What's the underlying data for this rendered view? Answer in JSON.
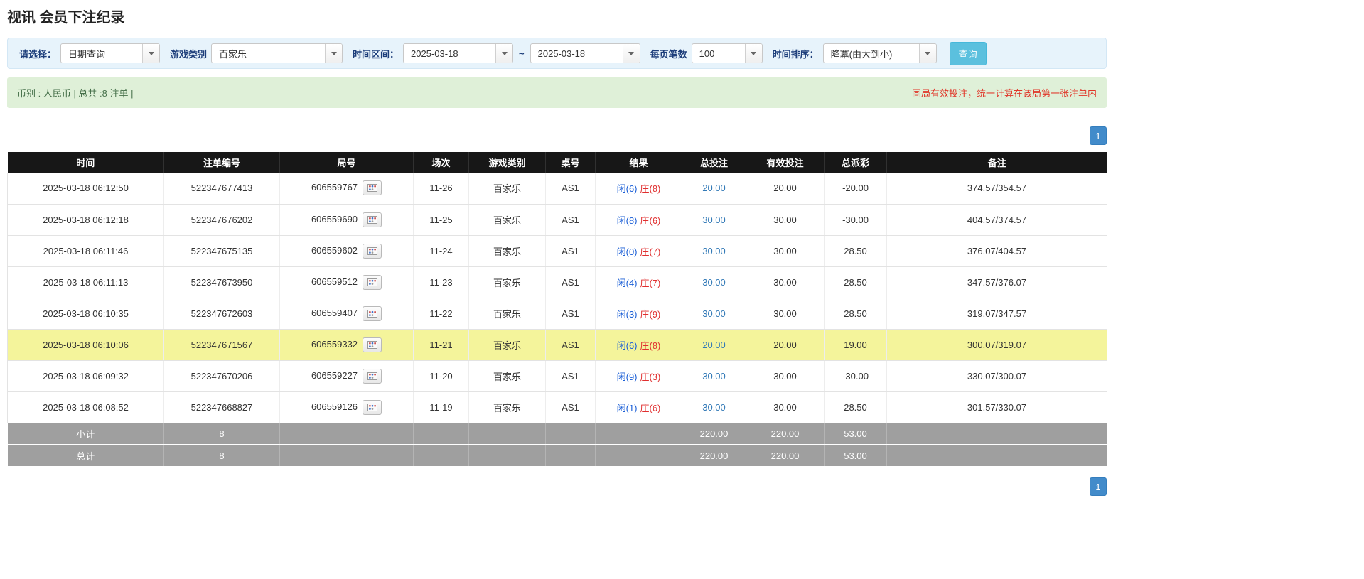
{
  "page": {
    "title": "视讯 会员下注纪录"
  },
  "filters": {
    "select": {
      "label": "请选择：",
      "value": "日期查询"
    },
    "game_type": {
      "label": "游戏类别",
      "value": "百家乐"
    },
    "time_range": {
      "label": "时间区间：",
      "from": "2025-03-18",
      "separator": "~",
      "to": "2025-03-18"
    },
    "per_page": {
      "label": "每页笔数",
      "value": "100"
    },
    "sort": {
      "label": "时间排序：",
      "value": "降冪(由大到小)"
    },
    "search_button": "查询"
  },
  "summary": {
    "info": "币别 : 人民币 | 总共 :8 注单 |",
    "notice": "同局有效投注，统一计算在该局第一张注单内"
  },
  "pagination": {
    "current_page": "1"
  },
  "table": {
    "headers": [
      "时间",
      "注单编号",
      "局号",
      "场次",
      "游戏类别",
      "桌号",
      "结果",
      "总投注",
      "有效投注",
      "总派彩",
      "备注"
    ],
    "rows": [
      {
        "time": "2025-03-18 06:12:50",
        "bet_id": "522347677413",
        "round_id": "606559767",
        "session": "11-26",
        "game": "百家乐",
        "table_no": "AS1",
        "result_player": "闲(6)",
        "result_banker": "庄(8)",
        "total_bet": "20.00",
        "valid_bet": "20.00",
        "payout": "-20.00",
        "remark": "374.57/354.57",
        "highlight": false
      },
      {
        "time": "2025-03-18 06:12:18",
        "bet_id": "522347676202",
        "round_id": "606559690",
        "session": "11-25",
        "game": "百家乐",
        "table_no": "AS1",
        "result_player": "闲(8)",
        "result_banker": "庄(6)",
        "total_bet": "30.00",
        "valid_bet": "30.00",
        "payout": "-30.00",
        "remark": "404.57/374.57",
        "highlight": false
      },
      {
        "time": "2025-03-18 06:11:46",
        "bet_id": "522347675135",
        "round_id": "606559602",
        "session": "11-24",
        "game": "百家乐",
        "table_no": "AS1",
        "result_player": "闲(0)",
        "result_banker": "庄(7)",
        "total_bet": "30.00",
        "valid_bet": "30.00",
        "payout": "28.50",
        "remark": "376.07/404.57",
        "highlight": false
      },
      {
        "time": "2025-03-18 06:11:13",
        "bet_id": "522347673950",
        "round_id": "606559512",
        "session": "11-23",
        "game": "百家乐",
        "table_no": "AS1",
        "result_player": "闲(4)",
        "result_banker": "庄(7)",
        "total_bet": "30.00",
        "valid_bet": "30.00",
        "payout": "28.50",
        "remark": "347.57/376.07",
        "highlight": false
      },
      {
        "time": "2025-03-18 06:10:35",
        "bet_id": "522347672603",
        "round_id": "606559407",
        "session": "11-22",
        "game": "百家乐",
        "table_no": "AS1",
        "result_player": "闲(3)",
        "result_banker": "庄(9)",
        "total_bet": "30.00",
        "valid_bet": "30.00",
        "payout": "28.50",
        "remark": "319.07/347.57",
        "highlight": false
      },
      {
        "time": "2025-03-18 06:10:06",
        "bet_id": "522347671567",
        "round_id": "606559332",
        "session": "11-21",
        "game": "百家乐",
        "table_no": "AS1",
        "result_player": "闲(6)",
        "result_banker": "庄(8)",
        "total_bet": "20.00",
        "valid_bet": "20.00",
        "payout": "19.00",
        "remark": "300.07/319.07",
        "highlight": true
      },
      {
        "time": "2025-03-18 06:09:32",
        "bet_id": "522347670206",
        "round_id": "606559227",
        "session": "11-20",
        "game": "百家乐",
        "table_no": "AS1",
        "result_player": "闲(9)",
        "result_banker": "庄(3)",
        "total_bet": "30.00",
        "valid_bet": "30.00",
        "payout": "-30.00",
        "remark": "330.07/300.07",
        "highlight": false
      },
      {
        "time": "2025-03-18 06:08:52",
        "bet_id": "522347668827",
        "round_id": "606559126",
        "session": "11-19",
        "game": "百家乐",
        "table_no": "AS1",
        "result_player": "闲(1)",
        "result_banker": "庄(6)",
        "total_bet": "30.00",
        "valid_bet": "30.00",
        "payout": "28.50",
        "remark": "301.57/330.07",
        "highlight": false
      }
    ],
    "subtotal": {
      "label": "小计",
      "count": "8",
      "total_bet": "220.00",
      "valid_bet": "220.00",
      "payout": "53.00"
    },
    "grand_total": {
      "label": "总计",
      "count": "8",
      "total_bet": "220.00",
      "valid_bet": "220.00",
      "payout": "53.00"
    }
  }
}
